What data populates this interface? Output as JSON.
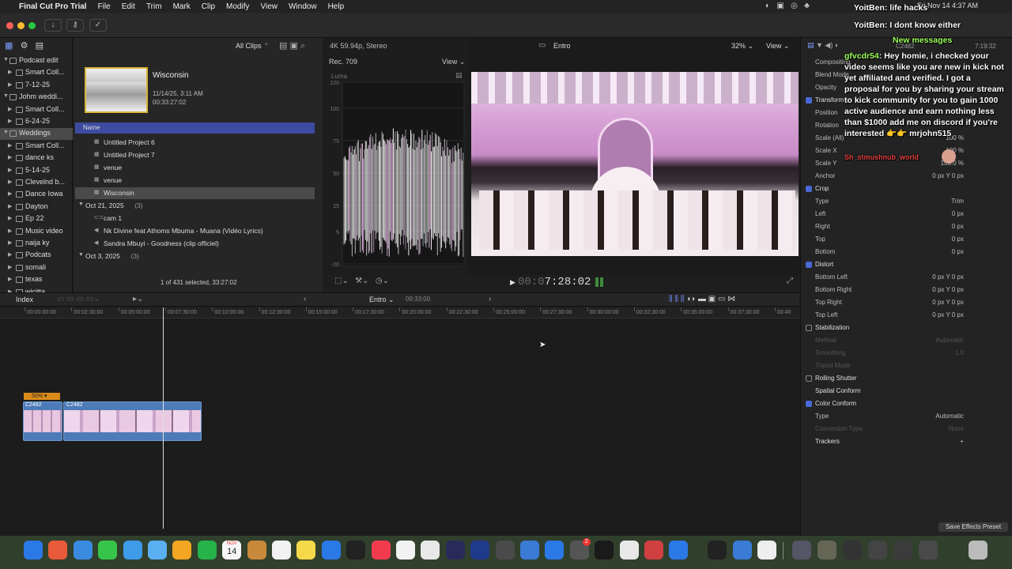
{
  "menubar": {
    "app_name": "Final Cut Pro Trial",
    "menus": [
      "File",
      "Edit",
      "Trim",
      "Mark",
      "Clip",
      "Modify",
      "View",
      "Window",
      "Help"
    ],
    "datetime": "Fri Nov 14  4:37 AM"
  },
  "sidebar": {
    "items": [
      {
        "label": "Podcast edit",
        "level": 0,
        "type": "library"
      },
      {
        "label": "Smart Coll...",
        "level": 1,
        "type": "folder"
      },
      {
        "label": "7-12-25",
        "level": 1,
        "type": "event"
      },
      {
        "label": "Johm weddi...",
        "level": 0,
        "type": "library"
      },
      {
        "label": "Smart Coll...",
        "level": 1,
        "type": "folder"
      },
      {
        "label": "6-24-25",
        "level": 1,
        "type": "event"
      },
      {
        "label": "Weddings",
        "level": 0,
        "type": "library",
        "selected": true
      },
      {
        "label": "Smart Coll...",
        "level": 1,
        "type": "folder"
      },
      {
        "label": "dance ks",
        "level": 1,
        "type": "event"
      },
      {
        "label": "5-14-25",
        "level": 1,
        "type": "event"
      },
      {
        "label": "Clevelnd b...",
        "level": 1,
        "type": "event"
      },
      {
        "label": "Dance  Iowa",
        "level": 1,
        "type": "event"
      },
      {
        "label": "Dayton",
        "level": 1,
        "type": "event"
      },
      {
        "label": "Ep 22",
        "level": 1,
        "type": "event"
      },
      {
        "label": "Music video",
        "level": 1,
        "type": "event"
      },
      {
        "label": "naija ky",
        "level": 1,
        "type": "event"
      },
      {
        "label": "Podcats",
        "level": 1,
        "type": "event"
      },
      {
        "label": "somali",
        "level": 1,
        "type": "event"
      },
      {
        "label": "texas",
        "level": 1,
        "type": "event"
      },
      {
        "label": "wicitta",
        "level": 1,
        "type": "event"
      }
    ]
  },
  "browser": {
    "filter": "All Clips",
    "preview_title": "Wisconsin",
    "preview_date": "11/14/25, 3:11 AM",
    "preview_duration": "00:33:27:02",
    "column_name": "Name",
    "rows": [
      {
        "label": "Untitled Project 6",
        "kind": "project",
        "indent": 1
      },
      {
        "label": "Untitled Project 7",
        "kind": "project",
        "indent": 1
      },
      {
        "label": "venue",
        "kind": "project",
        "indent": 1
      },
      {
        "label": "venue",
        "kind": "project",
        "indent": 1
      },
      {
        "label": "Wisconsin",
        "kind": "project",
        "indent": 1,
        "selected": true
      },
      {
        "label": "Oct 21, 2025",
        "count": "(3)",
        "kind": "group",
        "indent": 0
      },
      {
        "label": "cam 1",
        "kind": "clip",
        "indent": 1
      },
      {
        "label": "Nk Divine feat Athoms Mbuma - Muana (Vidéo Lyrics)",
        "kind": "audio",
        "indent": 1
      },
      {
        "label": "Sandra Mbuyi - Goodness (clip officiel)",
        "kind": "audio",
        "indent": 1
      },
      {
        "label": "Oct 3, 2025",
        "count": "(3)",
        "kind": "group",
        "indent": 0
      }
    ],
    "status": "1 of 431 selected, 33:27:02"
  },
  "viewer": {
    "format": "4K 59.94p, Stereo",
    "project": "Entro",
    "zoom": "32%",
    "view_label": "View",
    "timecode_dim": "00:0",
    "timecode": "7:28:02"
  },
  "scopes": {
    "colorspace": "Rec. 709",
    "view_label": "View",
    "mode": "Luma",
    "ticks": [
      "120",
      "100",
      "75",
      "50",
      "25",
      "5",
      "-20"
    ]
  },
  "inspector": {
    "clip_name": "C2482",
    "duration": "7:19:32",
    "rows": [
      {
        "k": "Compositing",
        "v": "",
        "type": "sub"
      },
      {
        "k": "Blend Mode",
        "v": "",
        "type": "sub"
      },
      {
        "k": "Opacity",
        "v": "",
        "type": "sub"
      },
      {
        "k": "Transform",
        "v": "",
        "type": "section",
        "checked": true
      },
      {
        "k": "Position",
        "v": "",
        "type": "sub"
      },
      {
        "k": "Rotation",
        "v": "",
        "type": "sub"
      },
      {
        "k": "Scale (All)",
        "v": "100 %",
        "type": "sub"
      },
      {
        "k": "Scale X",
        "v": "100 %",
        "type": "sub"
      },
      {
        "k": "Scale Y",
        "v": "100.0 %",
        "type": "sub"
      },
      {
        "k": "Anchor",
        "v": "0 px   Y   0 px",
        "type": "sub"
      },
      {
        "k": "Crop",
        "v": "",
        "type": "section",
        "checked": true
      },
      {
        "k": "Type",
        "v": "Trim",
        "type": "sub"
      },
      {
        "k": "Left",
        "v": "0 px",
        "type": "sub"
      },
      {
        "k": "Right",
        "v": "0 px",
        "type": "sub"
      },
      {
        "k": "Top",
        "v": "0 px",
        "type": "sub"
      },
      {
        "k": "Bottom",
        "v": "0 px",
        "type": "sub"
      },
      {
        "k": "Distort",
        "v": "",
        "type": "section",
        "checked": true
      },
      {
        "k": "Bottom Left",
        "v": "0 px   Y   0 px",
        "type": "sub"
      },
      {
        "k": "Bottom Right",
        "v": "0 px   Y   0 px",
        "type": "sub"
      },
      {
        "k": "Top Right",
        "v": "0 px   Y   0 px",
        "type": "sub"
      },
      {
        "k": "Top Left",
        "v": "0 px   Y   0 px",
        "type": "sub"
      },
      {
        "k": "Stabilization",
        "v": "",
        "type": "section",
        "checked": false
      },
      {
        "k": "Method",
        "v": "Automatic",
        "type": "dim"
      },
      {
        "k": "Smoothing",
        "v": "1.0",
        "type": "dim"
      },
      {
        "k": "Tripod Mode",
        "v": "",
        "type": "dim"
      },
      {
        "k": "Rolling Shutter",
        "v": "",
        "type": "section",
        "checked": false
      },
      {
        "k": "Spatial Conform",
        "v": "",
        "type": "section-nocb"
      },
      {
        "k": "Color Conform",
        "v": "",
        "type": "section",
        "checked": true
      },
      {
        "k": "Type",
        "v": "Automatic",
        "type": "sub"
      },
      {
        "k": "Conversion Type",
        "v": "None",
        "type": "dim"
      },
      {
        "k": "Trackers",
        "v": "+",
        "type": "section-nocb"
      }
    ],
    "save_preset": "Save Effects Preset"
  },
  "timeline": {
    "index_label": "Index",
    "project": "Entro",
    "project_duration": "09:33:00",
    "ruler": [
      "00:00:00:00",
      "00:02:30:00",
      "00:05:00:00",
      "00:07:30:00",
      "00:10:00:00",
      "00:12:30:00",
      "00:15:00:00",
      "00:17:30:00",
      "00:20:00:00",
      "00:22:30:00",
      "00:25:00:00",
      "00:27:30:00",
      "00:30:00:00",
      "00:32:30:00",
      "00:35:00:00",
      "00:37:30:00",
      "00:40"
    ],
    "speed_label": "50% ▾",
    "clips": [
      {
        "name": "C2482"
      },
      {
        "name": "C2482"
      }
    ]
  },
  "chat": {
    "lines": [
      {
        "user": "YoitBen",
        "text": "life hacks"
      },
      {
        "user": "YoitBen",
        "text": "I dont know either"
      }
    ],
    "new_messages": "New messages",
    "dm_user": "gfvcdr54",
    "dm_text": "Hey homie, i checked your video seems like you are new in kick not yet affiliated and verified. I got a proposal for you by sharing your stream to kick community for you to gain 1000 active audience and earn nothing less than $1000 add me on discord if you're interested 👉👉 mrjohn515",
    "last_user": "Sh_stmushnub_world"
  },
  "colors": {
    "accent": "#4a68d8",
    "selection": "#3d4ba0",
    "clip_audio": "#4d7bb8",
    "speed": "#d98a1a",
    "chat_user": "#9dff5a"
  },
  "dock": {
    "calendar_month": "NOV",
    "calendar_day": "14",
    "badge": "2"
  }
}
